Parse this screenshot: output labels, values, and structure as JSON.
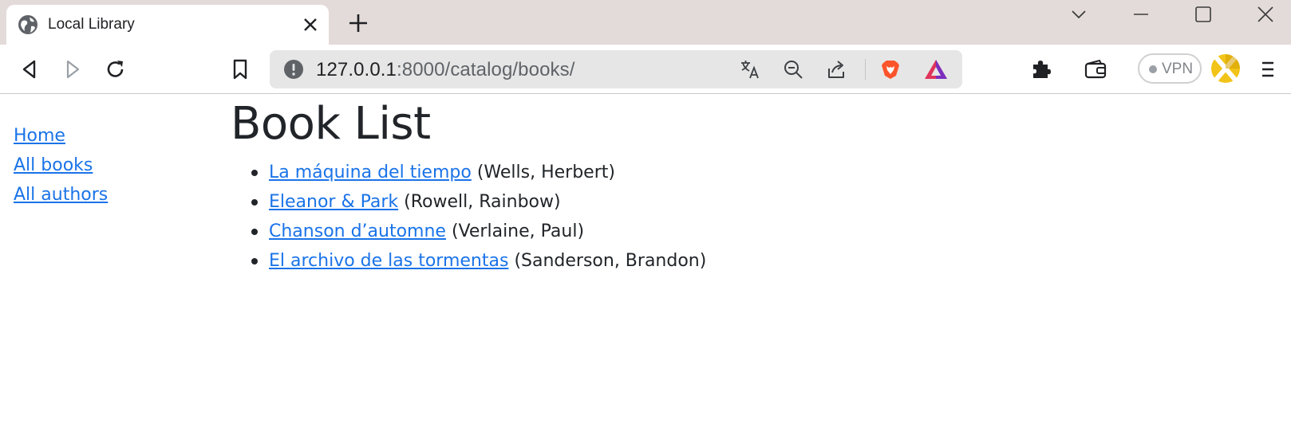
{
  "browser": {
    "tab": {
      "title": "Local Library"
    },
    "address": {
      "host": "127.0.0.1",
      "path": ":8000/catalog/books/"
    },
    "vpn_label": "VPN",
    "colors": {
      "tab_strip": "#e3dbd9",
      "omnibox": "#e6e6e6",
      "brave_orange": "#fb542b"
    }
  },
  "sidebar": {
    "links": [
      {
        "label": "Home"
      },
      {
        "label": "All books"
      },
      {
        "label": "All authors"
      }
    ]
  },
  "main": {
    "title": "Book List",
    "books": [
      {
        "title": "La máquina del tiempo",
        "author": "(Wells, Herbert)"
      },
      {
        "title": "Eleanor & Park",
        "author": "(Rowell, Rainbow)"
      },
      {
        "title": "Chanson d’automne",
        "author": "(Verlaine, Paul)"
      },
      {
        "title": "El archivo de las tormentas",
        "author": "(Sanderson, Brandon)"
      }
    ],
    "colors": {
      "link": "#1a73e8",
      "text": "#212529"
    }
  }
}
